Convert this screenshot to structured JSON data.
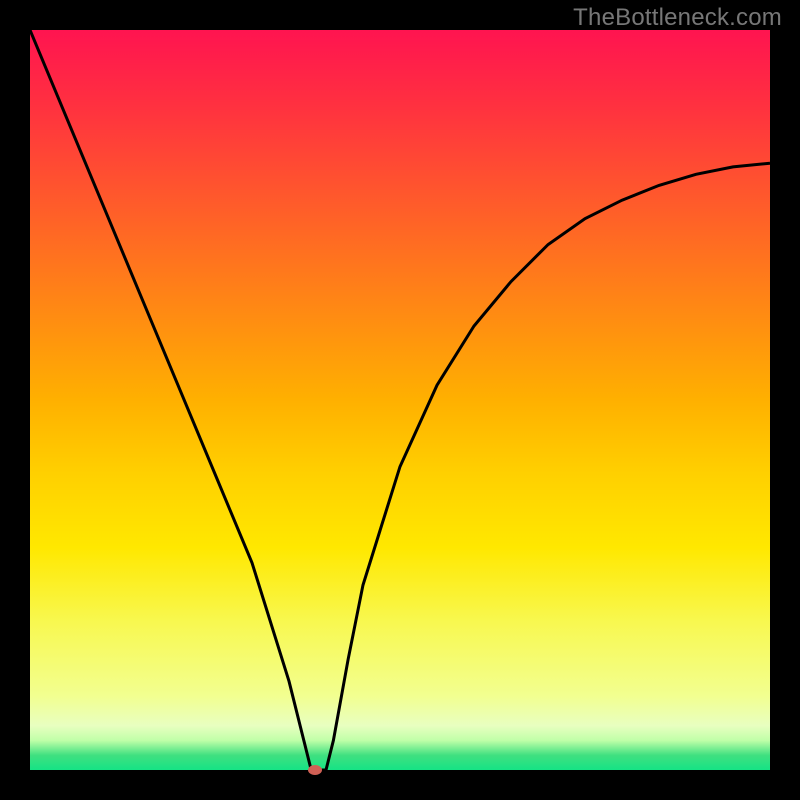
{
  "attribution": "TheBottleneck.com",
  "chart_data": {
    "type": "line",
    "title": "",
    "xlabel": "",
    "ylabel": "",
    "xlim": [
      0,
      100
    ],
    "ylim": [
      0,
      100
    ],
    "marker": {
      "x": 38.5,
      "y": 0
    },
    "series": [
      {
        "name": "bottleneck-curve",
        "x": [
          0,
          5,
          10,
          15,
          20,
          25,
          30,
          35,
          37,
          38,
          38.5,
          40,
          41,
          43,
          45,
          50,
          55,
          60,
          65,
          70,
          75,
          80,
          85,
          90,
          95,
          100
        ],
        "values": [
          100,
          88,
          76,
          64,
          52,
          40,
          28,
          12,
          4,
          0,
          0,
          0,
          4,
          15,
          25,
          41,
          52,
          60,
          66,
          71,
          74.5,
          77,
          79,
          80.5,
          81.5,
          82
        ]
      }
    ],
    "gradient_stops": [
      {
        "pos": 0.0,
        "color": "#ff1450"
      },
      {
        "pos": 0.1,
        "color": "#ff3040"
      },
      {
        "pos": 0.2,
        "color": "#ff5030"
      },
      {
        "pos": 0.3,
        "color": "#ff7020"
      },
      {
        "pos": 0.4,
        "color": "#ff9010"
      },
      {
        "pos": 0.5,
        "color": "#ffb000"
      },
      {
        "pos": 0.6,
        "color": "#ffd000"
      },
      {
        "pos": 0.7,
        "color": "#ffe800"
      },
      {
        "pos": 0.8,
        "color": "#f8f850"
      },
      {
        "pos": 0.9,
        "color": "#f2ff90"
      },
      {
        "pos": 0.94,
        "color": "#e8ffc0"
      },
      {
        "pos": 0.96,
        "color": "#c0ffa8"
      },
      {
        "pos": 0.98,
        "color": "#40e080"
      },
      {
        "pos": 1.0,
        "color": "#15e385"
      }
    ]
  }
}
